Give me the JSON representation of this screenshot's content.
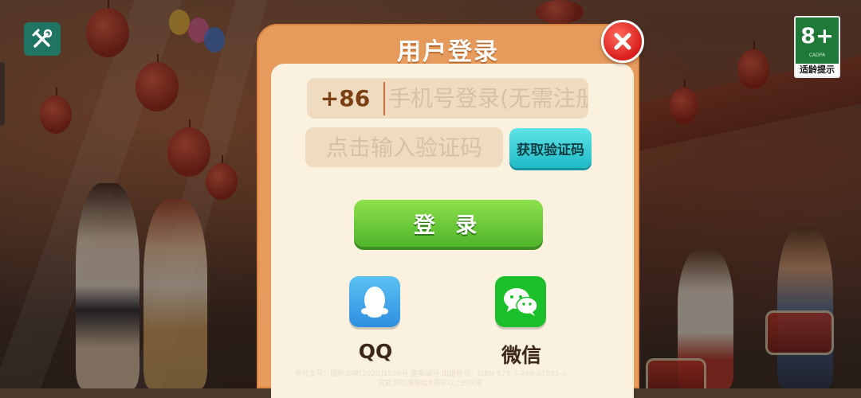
{
  "dialog": {
    "title": "用户登录",
    "phone": {
      "country_code": "+86",
      "placeholder": "手机号登录(无需注册)"
    },
    "code": {
      "placeholder": "点击输入验证码",
      "get_code_label": "获取验证码"
    },
    "login_label": "登 录",
    "social": [
      {
        "label": "QQ",
        "icon": "qq-penguin-icon",
        "color": "#2f8fe0"
      },
      {
        "label": "微信",
        "icon": "wechat-icon",
        "color": "#1bbf2a"
      }
    ]
  },
  "age_rating": {
    "value": "8+",
    "tag": "适龄提示"
  },
  "footer": {
    "line1": "审批文号：国新出审[2020]1558号  备案编号  出版物号：ISBN 978-7-498-07881-0",
    "line2": "这款游戏推荐给8周岁以上的玩家"
  },
  "colors": {
    "dialog_frame": "#e69b5c",
    "panel": "#fbf1df",
    "login_button": "#4fb52a",
    "get_code_button": "#1fbac7",
    "close_button": "#d81e1a"
  }
}
